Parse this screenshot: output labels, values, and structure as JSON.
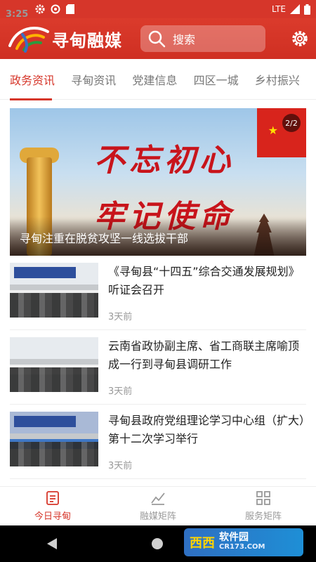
{
  "status_bar": {
    "time": "3:25",
    "network": "LTE"
  },
  "header": {
    "app_name": "寻甸融媒",
    "search_placeholder": "搜索",
    "brand_color": "#d6362a"
  },
  "tabs": [
    {
      "label": "政务资讯",
      "active": true
    },
    {
      "label": "寻甸资讯",
      "active": false
    },
    {
      "label": "党建信息",
      "active": false
    },
    {
      "label": "四区一城",
      "active": false
    },
    {
      "label": "乡村振兴",
      "active": false
    }
  ],
  "banner": {
    "slogan_line1": "不忘初心",
    "slogan_line2": "牢记使命",
    "caption": "寻甸注重在脱贫攻坚一线选拔干部",
    "page_indicator": "2/2"
  },
  "articles": [
    {
      "title": "《寻甸县“十四五”综合交通发展规划》听证会召开",
      "time": "3天前"
    },
    {
      "title": "云南省政协副主席、省工商联主席喻顶成一行到寻甸县调研工作",
      "time": "3天前"
    },
    {
      "title": "寻甸县政府党组理论学习中心组（扩大）第十二次学习举行",
      "time": "3天前"
    }
  ],
  "bottom_nav": [
    {
      "label": "今日寻甸",
      "icon": "news-icon",
      "active": true
    },
    {
      "label": "融媒矩阵",
      "icon": "matrix-icon",
      "active": false
    },
    {
      "label": "服务矩阵",
      "icon": "grid-icon",
      "active": false
    }
  ],
  "watermark": {
    "main": "西西",
    "name": "软件园",
    "url": "CR173.COM"
  }
}
